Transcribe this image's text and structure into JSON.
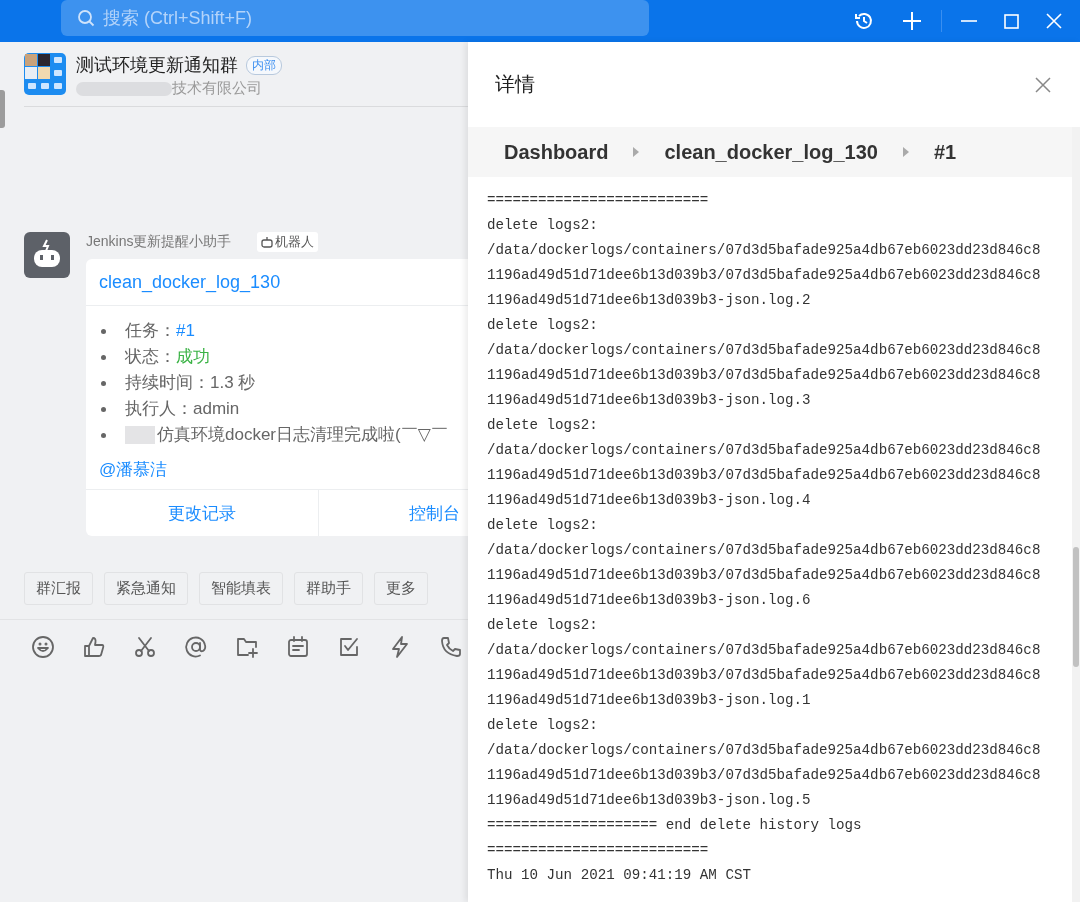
{
  "search": {
    "placeholder": "搜索 (Ctrl+Shift+F)"
  },
  "chat": {
    "title": "测试环境更新通知群",
    "badge": "内部",
    "subtitle": "技术有限公司",
    "message": {
      "sender": "Jenkins更新提醒小助手",
      "sender_badge": "机器人",
      "card": {
        "title": "clean_docker_log_130",
        "items": [
          {
            "kind": "link",
            "label": "任务：",
            "value": "#1"
          },
          {
            "kind": "success",
            "label": "状态：",
            "value": "成功"
          },
          {
            "kind": "plain",
            "label": "持续时间：",
            "value": "1.3 秒"
          },
          {
            "kind": "plain",
            "label": "执行人：",
            "value": "admin"
          },
          {
            "kind": "note",
            "value": "仿真环境docker日志清理完成啦(￣▽￣"
          }
        ],
        "mention": "@潘慕洁",
        "actions": [
          "更改记录",
          "控制台"
        ]
      }
    },
    "quick_actions": [
      "群汇报",
      "紧急通知",
      "智能填表",
      "群助手",
      "更多"
    ]
  },
  "details": {
    "title": "详情",
    "breadcrumb": [
      "Dashboard",
      "clean_docker_log_130",
      "#1"
    ],
    "log_lines": [
      "==========================",
      "delete logs2:",
      "/data/dockerlogs/containers/07d3d5bafade925a4db67eb6023dd23d846c8",
      "1196ad49d51d71dee6b13d039b3/07d3d5bafade925a4db67eb6023dd23d846c8",
      "1196ad49d51d71dee6b13d039b3-json.log.2",
      "delete logs2:",
      "/data/dockerlogs/containers/07d3d5bafade925a4db67eb6023dd23d846c8",
      "1196ad49d51d71dee6b13d039b3/07d3d5bafade925a4db67eb6023dd23d846c8",
      "1196ad49d51d71dee6b13d039b3-json.log.3",
      "delete logs2:",
      "/data/dockerlogs/containers/07d3d5bafade925a4db67eb6023dd23d846c8",
      "1196ad49d51d71dee6b13d039b3/07d3d5bafade925a4db67eb6023dd23d846c8",
      "1196ad49d51d71dee6b13d039b3-json.log.4",
      "delete logs2:",
      "/data/dockerlogs/containers/07d3d5bafade925a4db67eb6023dd23d846c8",
      "1196ad49d51d71dee6b13d039b3/07d3d5bafade925a4db67eb6023dd23d846c8",
      "1196ad49d51d71dee6b13d039b3-json.log.6",
      "delete logs2:",
      "/data/dockerlogs/containers/07d3d5bafade925a4db67eb6023dd23d846c8",
      "1196ad49d51d71dee6b13d039b3/07d3d5bafade925a4db67eb6023dd23d846c8",
      "1196ad49d51d71dee6b13d039b3-json.log.1",
      "delete logs2:",
      "/data/dockerlogs/containers/07d3d5bafade925a4db67eb6023dd23d846c8",
      "1196ad49d51d71dee6b13d039b3/07d3d5bafade925a4db67eb6023dd23d846c8",
      "1196ad49d51d71dee6b13d039b3-json.log.5",
      "==================== end delete history logs",
      "==========================",
      "Thu 10 Jun 2021 09:41:19 AM CST"
    ]
  }
}
